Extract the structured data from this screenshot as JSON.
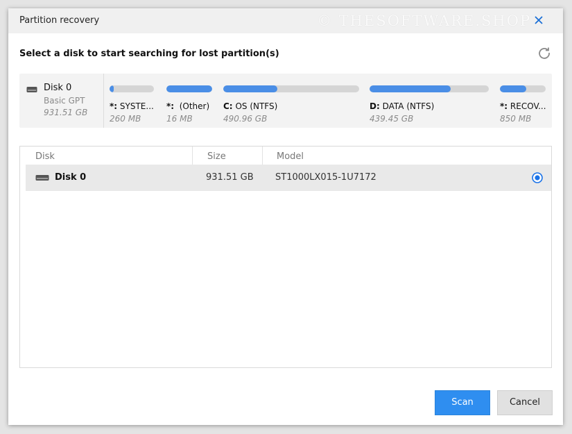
{
  "window": {
    "title": "Partition recovery",
    "watermark": "© THESOFTWARE.SHOP"
  },
  "heading": "Select a disk to start searching for lost partition(s)",
  "disk_map": {
    "disk_name": "Disk 0",
    "disk_type": "Basic GPT",
    "disk_size": "931.51 GB",
    "partitions": [
      {
        "letter": "*:",
        "label": "SYSTE...",
        "size": "260 MB",
        "used_fraction": 0.1
      },
      {
        "letter": "*:",
        "label": "(Other)",
        "size": "16 MB",
        "used_fraction": 1.0
      },
      {
        "letter": "C:",
        "label": "OS (NTFS)",
        "size": "490.96 GB",
        "used_fraction": 0.4
      },
      {
        "letter": "D:",
        "label": "DATA (NTFS)",
        "size": "439.45 GB",
        "used_fraction": 0.68
      },
      {
        "letter": "*:",
        "label": "RECOV...",
        "size": "850 MB",
        "used_fraction": 0.58
      }
    ]
  },
  "table": {
    "columns": [
      "Disk",
      "Size",
      "Model"
    ],
    "rows": [
      {
        "disk": "Disk 0",
        "size": "931.51 GB",
        "model": "ST1000LX015-1U7172",
        "selected": true
      }
    ]
  },
  "buttons": {
    "scan": "Scan",
    "cancel": "Cancel"
  },
  "colors": {
    "accent": "#2f8ef0",
    "bar_fill": "#4a8ee6",
    "bar_track": "#d5d5d5"
  },
  "icons": {
    "close": "close-icon",
    "refresh": "refresh-icon",
    "disk": "hard-disk-icon",
    "radio": "radio-selected-icon"
  }
}
